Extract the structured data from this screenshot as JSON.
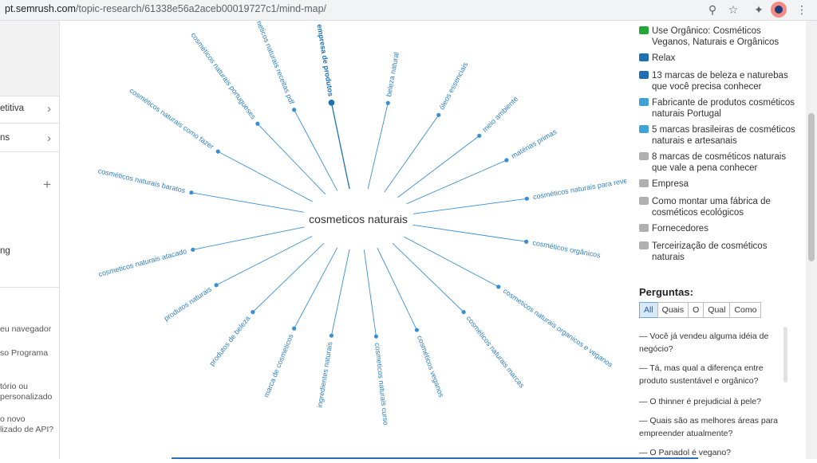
{
  "browser": {
    "url_host": "pt.semrush.com",
    "url_path": "/topic-research/61338e56a2aceb00019727c1/mind-map/"
  },
  "left_panel": {
    "row1": "etitiva",
    "row2": "ns",
    "row3": "ng",
    "lines": [
      "eu navegador",
      "so Programa",
      "tório ou",
      "personalizado",
      "o novo",
      "lizado de API?"
    ]
  },
  "mind_map": {
    "center": "cosmeticos naturais",
    "branches": [
      {
        "label": "empresa de produtos",
        "angle_deg": 99,
        "highlighted": true
      },
      {
        "label": "cosmeticos naturais receitas pdf",
        "angle_deg": 112
      },
      {
        "label": "cosméticos naturais portugueses",
        "angle_deg": 126
      },
      {
        "label": "cosméticos naturais como fazer",
        "angle_deg": 145
      },
      {
        "label": "cosméticos naturais baratos",
        "angle_deg": 167
      },
      {
        "label": "cosmeticos naturais atacado",
        "angle_deg": 195
      },
      {
        "label": "produtos naturais",
        "angle_deg": 214
      },
      {
        "label": "produtos de beleza",
        "angle_deg": 232
      },
      {
        "label": "marca de cosmeticos",
        "angle_deg": 248
      },
      {
        "label": "ingredientes naturais",
        "angle_deg": 261
      },
      {
        "label": "cosmeticos naturais curso",
        "angle_deg": 276
      },
      {
        "label": "cosméticos veganos",
        "angle_deg": 290
      },
      {
        "label": "cosméticos naturais marcas",
        "angle_deg": 308
      },
      {
        "label": "cosmeticos naturais organicos e veganos",
        "angle_deg": 325
      },
      {
        "label": "cosméticos orgânicos",
        "angle_deg": 349
      },
      {
        "label": "cosméticos naturais para revenda",
        "angle_deg": 10
      },
      {
        "label": "matérias primas",
        "angle_deg": 30
      },
      {
        "label": "meio ambiente",
        "angle_deg": 45
      },
      {
        "label": "óleos essenciais",
        "angle_deg": 62
      },
      {
        "label": "beleza natural",
        "angle_deg": 80
      }
    ]
  },
  "headlines": [
    {
      "title": "Use Orgânico: Cosméticos Veganos, Naturais e Orgânicos",
      "color": "#22a83a"
    },
    {
      "title": "Relax",
      "color": "#1f6fb3"
    },
    {
      "title": "13 marcas de beleza e naturebas que você precisa conhecer",
      "color": "#1f6fb3"
    },
    {
      "title": "Fabricante de produtos cosméticos naturais Portugal",
      "color": "#3fa3d9"
    },
    {
      "title": "5 marcas brasileiras de cosméticos naturais e artesanais",
      "color": "#3fa3d9"
    },
    {
      "title": "8 marcas de cosméticos naturais que vale a pena conhecer",
      "color": "#b0b0b0"
    },
    {
      "title": "Empresa",
      "color": "#b0b0b0"
    },
    {
      "title": "Como montar uma fábrica de cosméticos ecológicos",
      "color": "#b0b0b0"
    },
    {
      "title": "Fornecedores",
      "color": "#b0b0b0"
    },
    {
      "title": "Terceirização de cosméticos naturais",
      "color": "#b0b0b0"
    }
  ],
  "questions": {
    "title": "Perguntas:",
    "tabs": [
      "All",
      "Quais",
      "O",
      "Qual",
      "Como"
    ],
    "active_tab": "All",
    "items": [
      "— Você já vendeu alguma idéia de negócio?",
      "— Tá, mas qual a diferença entre produto sustentável e orgânico?",
      "— O thinner é prejudicial à pele?",
      "— Quais são as melhores áreas para empreender atualmente?",
      "— O Panadol é vegano?"
    ]
  },
  "colors": {
    "branch": "#3a8fd0",
    "branch_text": "#2f7fbf",
    "highlight": "#1f6fb3",
    "center_text": "#333333"
  }
}
